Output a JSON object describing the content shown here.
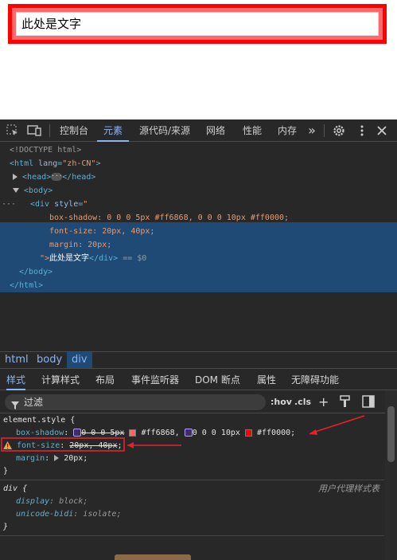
{
  "preview": {
    "text": "此处是文字"
  },
  "toolbar": {
    "tabs": [
      "控制台",
      "元素",
      "源代码/来源",
      "网络",
      "性能",
      "内存"
    ],
    "active_tab": "元素",
    "more_label": "»"
  },
  "dom": {
    "doctype": "<!DOCTYPE html>",
    "html_open_tag": "html",
    "html_lang_attr": "lang",
    "html_lang_value": "\"zh-CN\"",
    "head_open": "<head>",
    "head_close": "</head>",
    "body_open": "<body>",
    "div_open_prefix": "<div",
    "div_style_attr": "style",
    "div_style_open": "\"",
    "style_lines": [
      "box-shadow: 0 0 0 5px #ff6868, 0 0 0 10px #ff0000;",
      "font-size: 20px, 40px;",
      "margin: 20px;"
    ],
    "div_style_close": "\">",
    "div_text": "此处是文字",
    "div_close": "</div>",
    "dollar": "== $0",
    "body_close": "</body>",
    "html_close": "</html>",
    "row_dots": "···"
  },
  "breadcrumb": [
    "html",
    "body",
    "div"
  ],
  "subtabs": [
    "样式",
    "计算样式",
    "布局",
    "事件监听器",
    "DOM 断点",
    "属性",
    "无障碍功能"
  ],
  "filter": {
    "placeholder": "过滤",
    "hov": ":hov",
    "cls": ".cls",
    "plus": "+"
  },
  "styles": {
    "element_style_selector": "element.style {",
    "box_shadow_prop": "box-shadow",
    "box_shadow_part1": "0 0 0 5px",
    "box_shadow_color1": "#ff6868",
    "box_shadow_part2": "0 0 0 10px",
    "box_shadow_color2": "#ff0000",
    "font_size_prop": "font-size",
    "font_size_value": "20px, 40px",
    "margin_prop": "margin",
    "margin_value": "20px",
    "close_brace": "}",
    "div_selector": "div {",
    "ua_label": "用户代理样式表",
    "display_prop": "display",
    "display_value": "block",
    "unicode_prop": "unicode-bidi",
    "unicode_value": "isolate"
  },
  "colors": {
    "accent": "#8ab4f8",
    "swatch1": "#ff6868",
    "swatch2": "#ff0000",
    "annotation": "#e8202a"
  }
}
